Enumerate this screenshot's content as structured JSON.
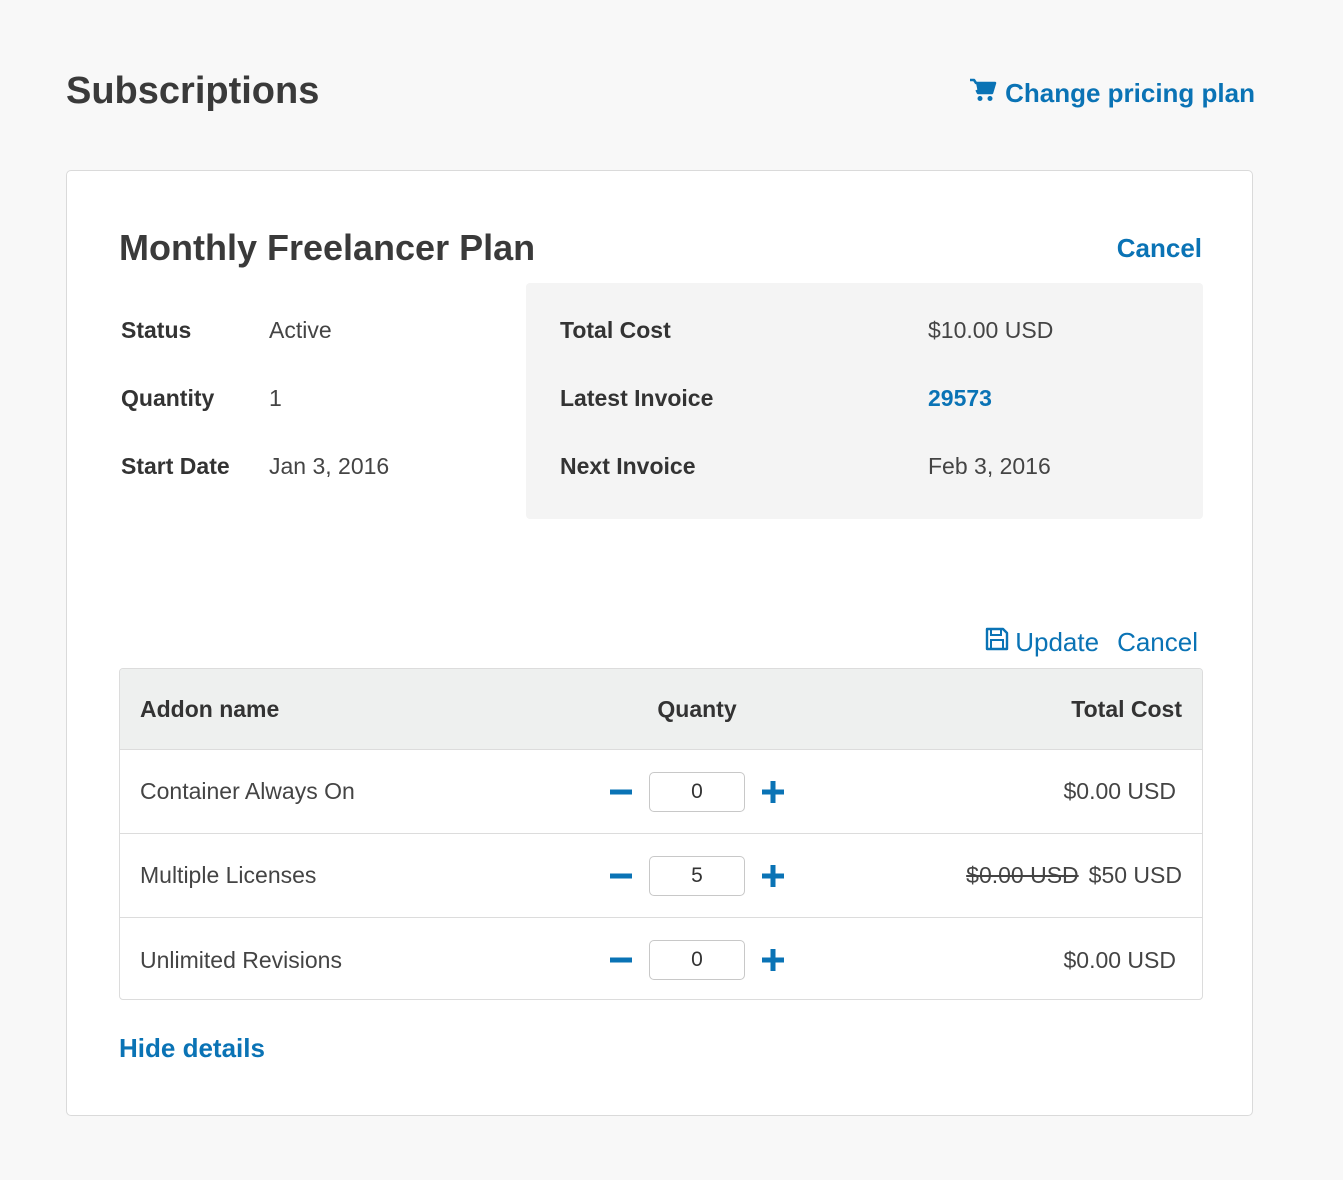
{
  "header": {
    "title": "Subscriptions",
    "change_plan_label": "Change pricing plan",
    "change_plan_icon": "shopping-cart-icon"
  },
  "plan": {
    "name": "Monthly Freelancer Plan",
    "cancel_label": "Cancel",
    "details": [
      {
        "label": "Status",
        "value": "Active"
      },
      {
        "label": "Quantity",
        "value": "1"
      },
      {
        "label": "Start Date",
        "value": "Jan 3, 2016"
      }
    ],
    "summary": {
      "total_cost_label": "Total Cost",
      "total_cost_value": "$10.00 USD",
      "latest_invoice_label": "Latest Invoice",
      "latest_invoice_value": "29573",
      "next_invoice_label": "Next Invoice",
      "next_invoice_value": "Feb 3, 2016"
    }
  },
  "addons": {
    "update_label": "Update",
    "update_icon": "floppy-disk-icon",
    "cancel_label": "Cancel",
    "columns": {
      "name": "Addon name",
      "quantity": "Quanty",
      "total_cost": "Total Cost"
    },
    "rows": [
      {
        "name": "Container Always On",
        "quantity": "0",
        "old_cost": "",
        "cost": "$0.00 USD"
      },
      {
        "name": "Multiple Licenses",
        "quantity": "5",
        "old_cost": "$0.00 USD",
        "cost": "$50 USD"
      },
      {
        "name": "Unlimited Revisions",
        "quantity": "0",
        "old_cost": "",
        "cost": "$0.00 USD"
      }
    ]
  },
  "footer": {
    "hide_details_label": "Hide details"
  },
  "colors": {
    "link": "#0a73b5",
    "background": "#f8f8f8",
    "header_row": "#eef0ef",
    "summary_box": "#f4f4f4"
  }
}
